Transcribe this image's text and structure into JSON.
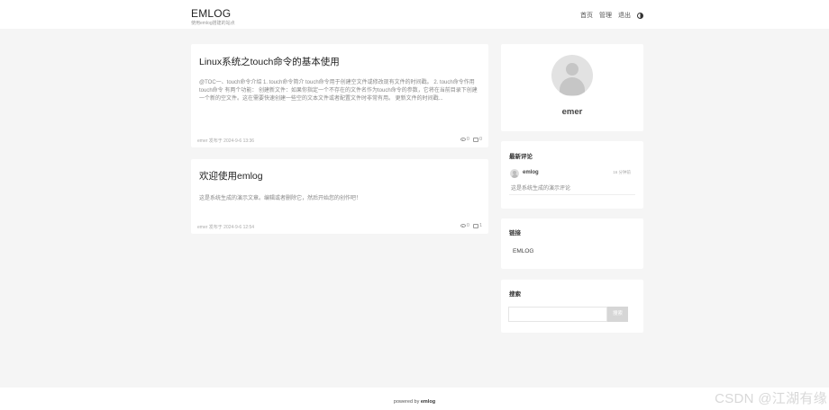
{
  "header": {
    "brand_name": "EMLOG",
    "brand_subtitle": "使用emlog搭建的站点",
    "nav": [
      "首页",
      "管理",
      "退出"
    ]
  },
  "posts": [
    {
      "title": "Linux系统之touch命令的基本使用",
      "excerpt": "@TOC一、touch命令介绍 1. touch命令简介 touch命令用于创建空文件或修改现有文件的时间戳。 2. touch命令作用 touch命令 有两个功能： 创建新文件：如果你指定一个不存在的文件名作为touch命令的参数，它将在当前目录下创建一个新的空文件。这在需要快速创建一些空的文本文件或者配置文件时非常有用。 更新文件的时间戳...",
      "meta": "emer 发布于 2024-9-6 13:36",
      "views": "0",
      "comments": "0"
    },
    {
      "title": "欢迎使用emlog",
      "excerpt": "这是系统生成的演示文章。编辑或者删除它，然后开始您的创作吧！",
      "meta": "emer 发布于 2024-9-6 12:54",
      "views": "0",
      "comments": "1"
    }
  ],
  "sidebar": {
    "profile_name": "emer",
    "latest_comments": {
      "title": "最新评论",
      "user": "emlog",
      "time": "16 分钟前",
      "text": "这是系统生成的演示评论"
    },
    "links": {
      "title": "链接",
      "items": [
        "EMLOG"
      ]
    },
    "search": {
      "title": "搜索",
      "placeholder": "",
      "button": "搜索"
    }
  },
  "footer": {
    "prefix": "powered by",
    "brand": "emlog"
  },
  "watermark": "CSDN @江湖有缘"
}
